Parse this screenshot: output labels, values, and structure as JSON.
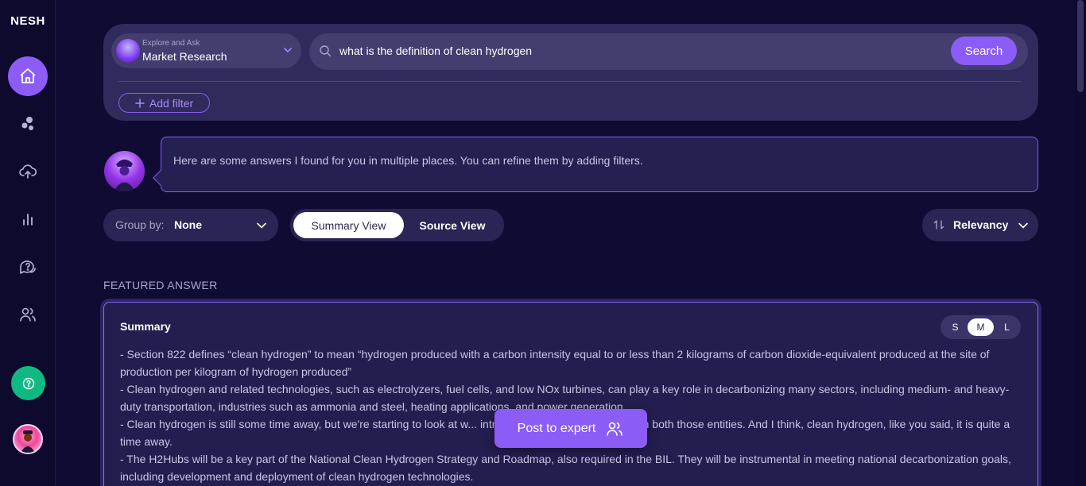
{
  "app": {
    "logo": "NESH"
  },
  "sidebar": {
    "items": [
      {
        "name": "home",
        "icon": "home-icon",
        "active": true
      },
      {
        "name": "bubbles",
        "icon": "bubbles-icon",
        "active": false
      },
      {
        "name": "upload",
        "icon": "cloud-upload-icon",
        "active": false
      },
      {
        "name": "analytics",
        "icon": "bar-chart-icon",
        "active": false
      },
      {
        "name": "questions",
        "icon": "question-chat-icon",
        "active": false
      },
      {
        "name": "users",
        "icon": "users-icon",
        "active": false
      }
    ],
    "help_icon": "help-icon",
    "colors": {
      "active": "#8b5cf6",
      "help": "#10b981"
    }
  },
  "search": {
    "mode_caption": "Explore and Ask",
    "mode_value": "Market Research",
    "query": "what is the definition of clean hydrogen",
    "button_label": "Search",
    "add_filter_label": "Add filter"
  },
  "assistant": {
    "message": "Here are some answers I found for you in multiple places. You can refine them by adding filters."
  },
  "controls": {
    "group_by_label": "Group by:",
    "group_by_value": "None",
    "views": [
      "Summary View",
      "Source View"
    ],
    "active_view": "Summary View",
    "sort_value": "Relevancy"
  },
  "featured": {
    "section_label": "FEATURED ANSWER",
    "title": "Summary",
    "sizes": [
      "S",
      "M",
      "L"
    ],
    "active_size": "M",
    "lines": [
      "- Section 822 defines “clean hydrogen” to mean “hydrogen produced with a carbon intensity equal to or less than 2 kilograms of carbon dioxide-equivalent produced at the site of production per kilogram of hydrogen produced”",
      "- Clean hydrogen and related technologies, such as electrolyzers, fuel cells, and low NOx turbines, can play a key role in decarbonizing many sectors, including medium- and heavy-duty transportation, industries such as ammonia and steel, heating applications, and power generation.",
      "- Clean hydrogen is still some time away, but we're starting to look at w... introduce products and services in both those entities. And I think, clean hydrogen, like you said, it is quite a time away.",
      "- The H2Hubs will be a key part of the National Clean Hydrogen Strategy and Roadmap, also required in the BIL. They will be instrumental in meeting national decarbonization goals, including development and deployment of clean hydrogen technologies."
    ]
  },
  "floating": {
    "post_expert_label": "Post to expert"
  },
  "colors": {
    "background": "#0f0b33",
    "accent": "#8b5cf6",
    "panel": "#302b5c"
  }
}
